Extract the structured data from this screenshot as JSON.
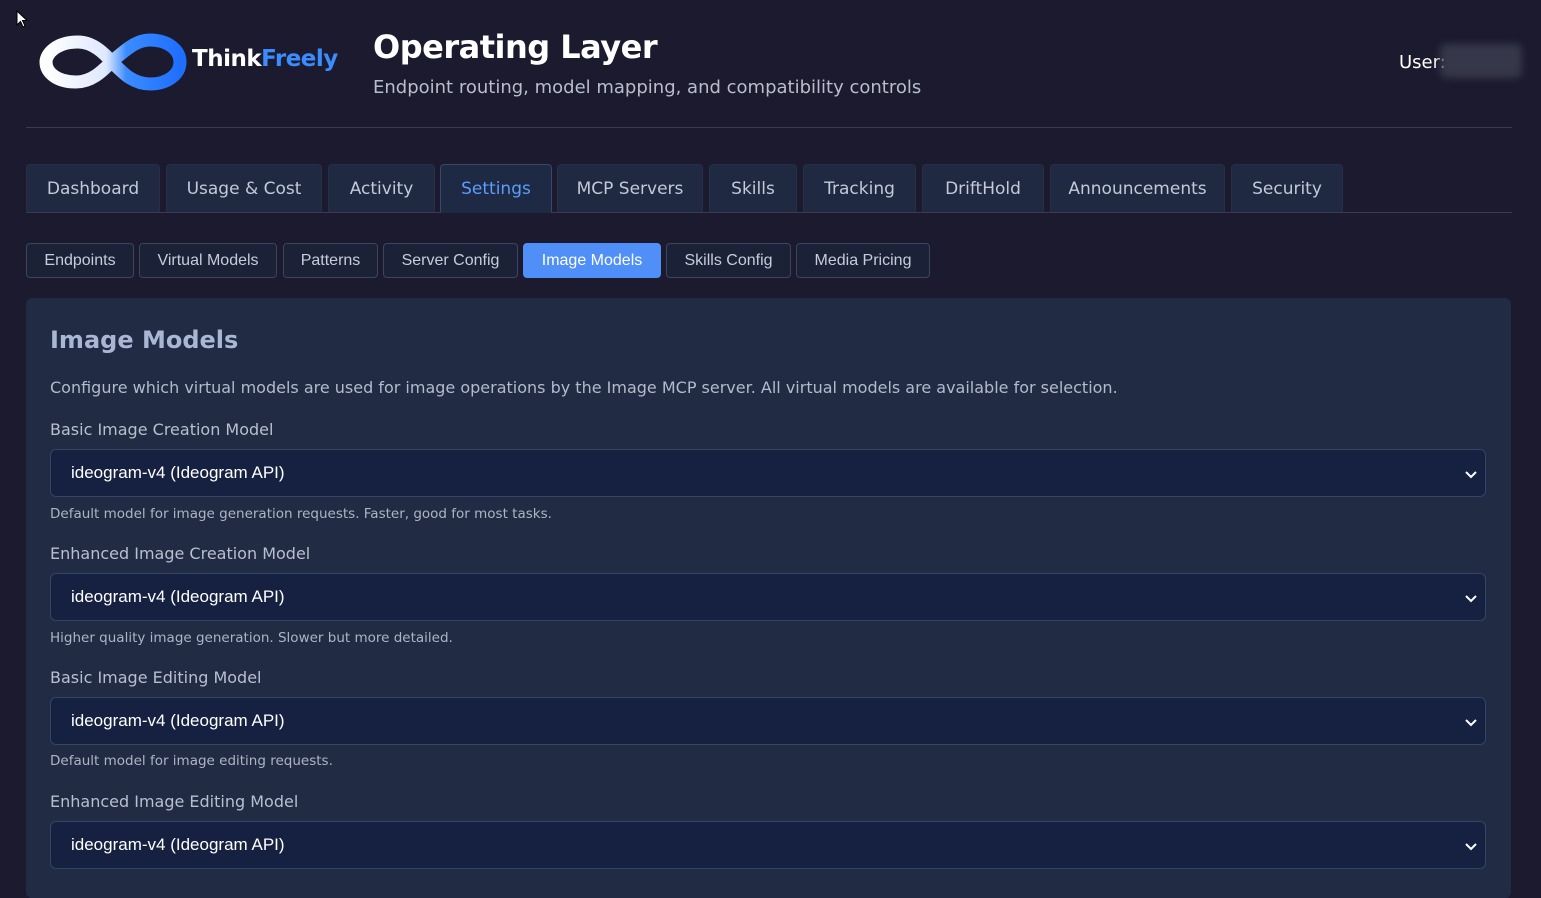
{
  "header": {
    "brand_think": "Think",
    "brand_freely": "Freely",
    "title": "Operating Layer",
    "subtitle": "Endpoint routing, model mapping, and compatibility controls",
    "user_label": "User:"
  },
  "tabs": [
    {
      "label": "Dashboard"
    },
    {
      "label": "Usage & Cost"
    },
    {
      "label": "Activity"
    },
    {
      "label": "Settings",
      "active": true
    },
    {
      "label": "MCP Servers"
    },
    {
      "label": "Skills"
    },
    {
      "label": "Tracking"
    },
    {
      "label": "DriftHold"
    },
    {
      "label": "Announcements"
    },
    {
      "label": "Security"
    }
  ],
  "subtabs": [
    {
      "label": "Endpoints"
    },
    {
      "label": "Virtual Models"
    },
    {
      "label": "Patterns"
    },
    {
      "label": "Server Config"
    },
    {
      "label": "Image Models",
      "active": true
    },
    {
      "label": "Skills Config"
    },
    {
      "label": "Media Pricing"
    }
  ],
  "panel": {
    "title": "Image Models",
    "description": "Configure which virtual models are used for image operations by the Image MCP server. All virtual models are available for selection.",
    "fields": [
      {
        "label": "Basic Image Creation Model",
        "value": "ideogram-v4 (Ideogram API)",
        "hint": "Default model for image generation requests. Faster, good for most tasks."
      },
      {
        "label": "Enhanced Image Creation Model",
        "value": "ideogram-v4 (Ideogram API)",
        "hint": "Higher quality image generation. Slower but more detailed."
      },
      {
        "label": "Basic Image Editing Model",
        "value": "ideogram-v4 (Ideogram API)",
        "hint": "Default model for image editing requests."
      },
      {
        "label": "Enhanced Image Editing Model",
        "value": "ideogram-v4 (Ideogram API)",
        "hint": ""
      }
    ]
  },
  "colors": {
    "background": "#1b1a2e",
    "accent": "#4f8ff7",
    "panel": "#212b44"
  }
}
